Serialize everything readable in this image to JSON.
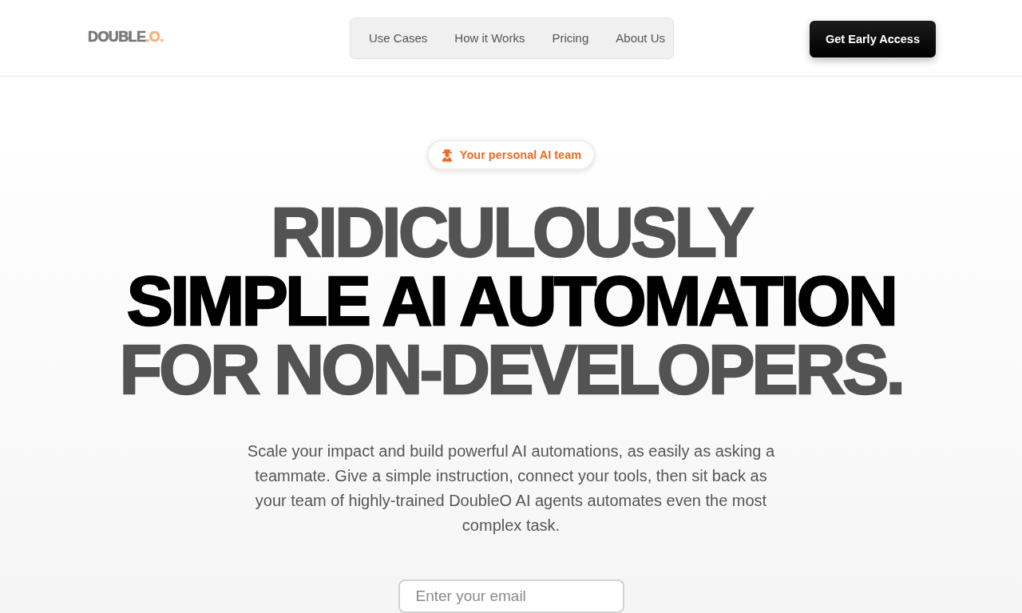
{
  "header": {
    "logo": {
      "text": "DOUBLE",
      "accent": ".O."
    },
    "nav": [
      {
        "label": "Use Cases"
      },
      {
        "label": "How it Works"
      },
      {
        "label": "Pricing"
      },
      {
        "label": "About Us"
      }
    ],
    "cta": "Get Early Access"
  },
  "hero": {
    "badge": "Your personal AI team",
    "headline": [
      {
        "text": "RIDICULOUSLY",
        "emphasis": false
      },
      {
        "text": "SIMPLE AI AUTOMATION",
        "emphasis": true
      },
      {
        "text": "FOR NON-DEVELOPERS.",
        "emphasis": false
      }
    ],
    "description": "Scale your impact and build powerful AI automations, as easily as asking a teammate. Give a simple instruction, connect your tools, then sit back as your team of highly-trained DoubleO AI agents automates even the most complex task.",
    "email_field": {
      "placeholder": "Enter your email"
    }
  }
}
